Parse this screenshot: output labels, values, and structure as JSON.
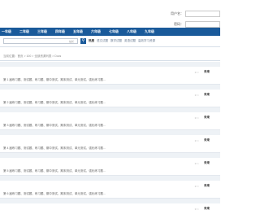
{
  "login": {
    "username_label": "用户名：",
    "password_label": "密码："
  },
  "nav": {
    "items": [
      "一年级",
      "二年级",
      "三年级",
      "四年级",
      "五年级",
      "六年级",
      "七年级",
      "八年级",
      "九年级"
    ]
  },
  "search": {
    "placeholder": "",
    "suffix": "站长",
    "button_icon": "search-icon",
    "hot_tags": [
      "热搜",
      "语文试题",
      "数学试题",
      "英语试题",
      "高效学习资源"
    ]
  },
  "breadcrumb": "当前位置：首页 > 100 > 全部资源列表 > Docs",
  "items": [
    {
      "views": "0 ☆",
      "author": "未来",
      "desc": "第 1 届练习题、测试题、练习题、期中测试、期末测试、单元测试、强化练习题..."
    },
    {
      "views": "0 ☆",
      "author": "未来",
      "desc": "第 2 届练习题、测试题、练习题、期中测试、期末测试、单元测试、强化练习题..."
    },
    {
      "views": "0 ☆",
      "author": "未来",
      "desc": "第 3 届练习题、测试题、练习题、期中测试、期末测试、单元测试、强化练习题..."
    },
    {
      "views": "0 ☆",
      "author": "未来",
      "desc": "第 4 届练习题、测试题、练习题、期中测试、期末测试、单元测试、强化练习题..."
    },
    {
      "views": "0 ☆",
      "author": "未来",
      "desc": "第 5 届练习题、测试题、练习题、期中测试、期末测试、单元测试、强化练习题..."
    },
    {
      "views": "0 ☆",
      "author": "未来",
      "desc": "第 6 届练习题、测试题、练习题、期中测试、期末测试、单元测试、强化练习题..."
    },
    {
      "views": "0 ☆",
      "author": "未来",
      "desc": ""
    }
  ]
}
